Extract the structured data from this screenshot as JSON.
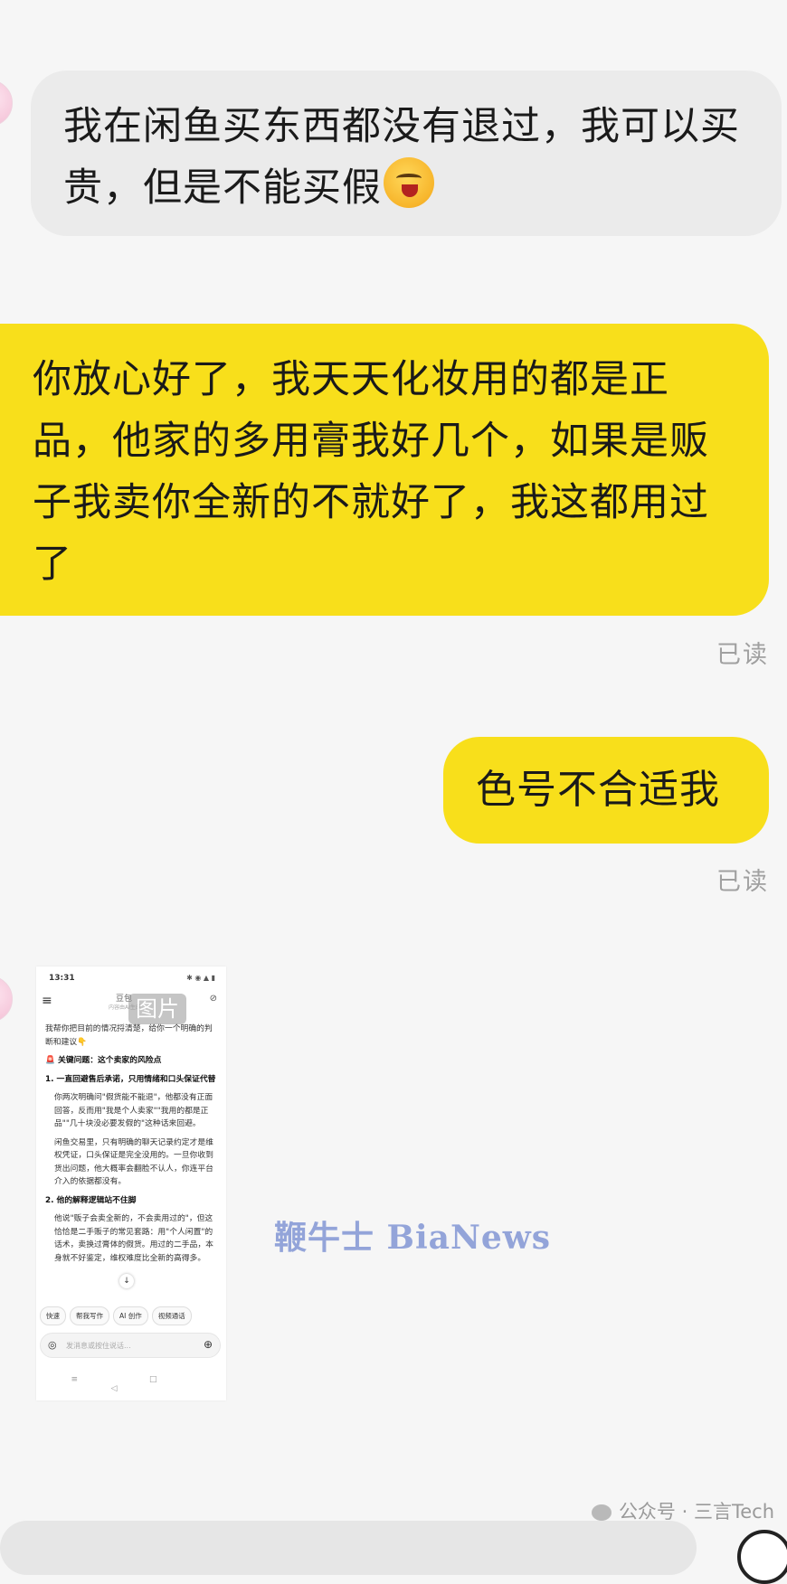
{
  "messages": {
    "incoming_1": {
      "text": "我在闲鱼买东西都没有退过，我可以买贵，但是不能买假",
      "emoji": "crying-laughing-emoji"
    },
    "outgoing_1": {
      "text": "你放心好了，我天天化妆用的都是正品，他家的多用膏我好几个，如果是贩子我卖你全新的不就好了，我这都用过了",
      "read_status": "已读"
    },
    "outgoing_2": {
      "text": "色号不合适我",
      "read_status": "已读"
    }
  },
  "image_message": {
    "tag": "图片",
    "status_time": "13:31",
    "status_icons": "✱ ◉ ▲ ▮",
    "header_title": "豆包",
    "header_subtitle": "内容由AI生成",
    "intro": "我帮你把目前的情况捋清楚，给你一个明确的判断和建议👇",
    "section_heading": "🚨 关键问题：这个卖家的风险点",
    "point1_title": "1. 一直回避售后承诺，只用情绪和口头保证代替",
    "point1_para1": "你两次明确问\"假货能不能退\"，他都没有正面回答，反而用\"我是个人卖家\"\"我用的都是正品\"\"几十块没必要发假的\"这种话来回避。",
    "point1_para2": "闲鱼交易里，只有明确的聊天记录约定才是维权凭证，口头保证是完全没用的。一旦你收到货出问题，他大概率会翻脸不认人，你连平台介入的依据都没有。",
    "point2_title": "2. 他的解释逻辑站不住脚",
    "point2_para": "他说\"贩子会卖全新的，不会卖用过的\"，但这恰恰是二手贩子的常见套路：用\"个人闲置\"的话术，卖换过膏体的假货。用过的二手品，本身就不好鉴定，维权难度比全新的高得多。",
    "chips": [
      "快速",
      "帮我写作",
      "AI 创作",
      "视频通话"
    ],
    "input_placeholder": "发消息或按住说话...",
    "nav_icons": "≡ □ ◁"
  },
  "watermark": "鞭牛士 BiaNews",
  "footer": {
    "source": "公众号 · 三言Tech"
  },
  "colors": {
    "outgoing_bubble": "#f8df1b",
    "incoming_bubble": "#ebebeb",
    "background": "#f6f6f6",
    "read_text": "#a0a0a0",
    "watermark": "#93a4d9"
  }
}
